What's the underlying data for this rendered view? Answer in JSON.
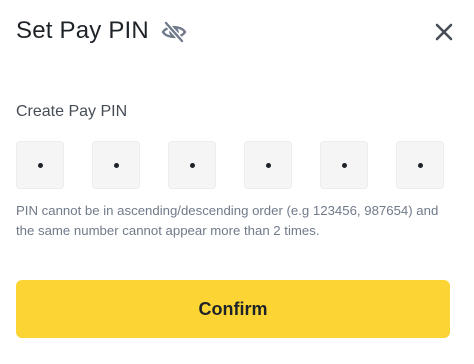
{
  "dialog": {
    "title": "Set Pay PIN",
    "visibility_icon": "eye-slash-icon",
    "close_icon": "close-icon"
  },
  "pin": {
    "label": "Create Pay PIN",
    "cells": [
      "•",
      "•",
      "•",
      "•",
      "•",
      "•"
    ],
    "hint": "PIN cannot be in ascending/descending order (e.g 123456, 987654) and the same number cannot appear more than 2 times."
  },
  "actions": {
    "confirm_label": "Confirm"
  },
  "colors": {
    "accent": "#fcd535",
    "text_primary": "#1e2329",
    "text_secondary": "#707a8a",
    "icon": "#707a8a",
    "cell_background": "#f5f5f5"
  }
}
